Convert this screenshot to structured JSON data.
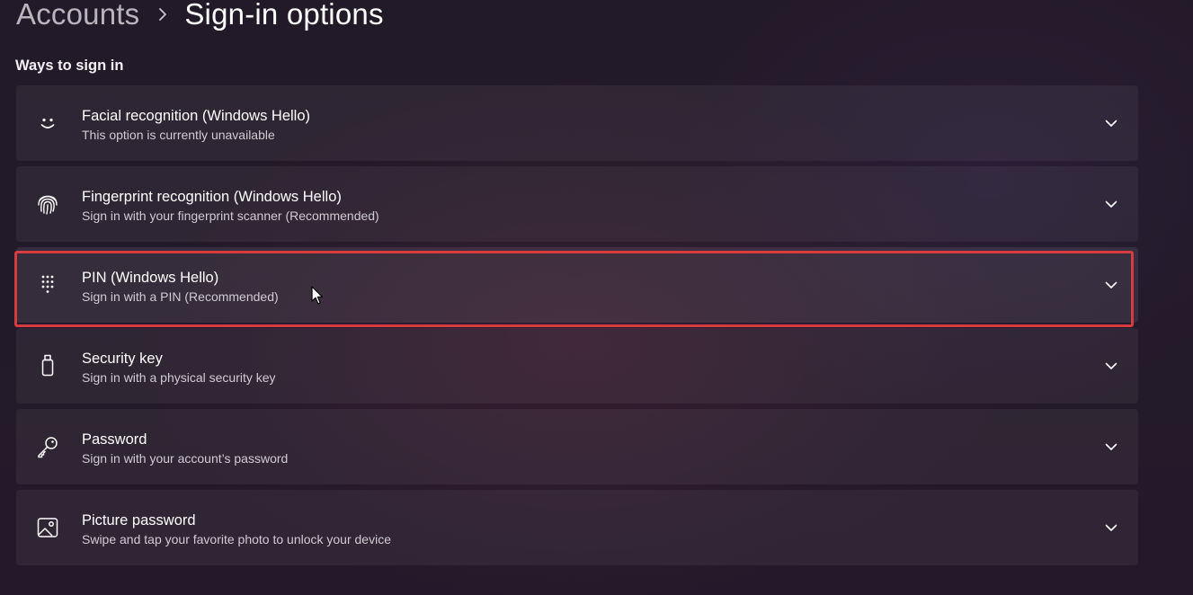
{
  "breadcrumb": {
    "parent": "Accounts",
    "separator_icon": "chevron-right-icon",
    "current": "Sign-in options"
  },
  "section": {
    "title": "Ways to sign in"
  },
  "options": [
    {
      "icon": "face-icon",
      "title": "Facial recognition (Windows Hello)",
      "description": "This option is currently unavailable"
    },
    {
      "icon": "fingerprint-icon",
      "title": "Fingerprint recognition (Windows Hello)",
      "description": "Sign in with your fingerprint scanner (Recommended)"
    },
    {
      "icon": "pin-keypad-icon",
      "title": "PIN (Windows Hello)",
      "description": "Sign in with a PIN (Recommended)"
    },
    {
      "icon": "usb-key-icon",
      "title": "Security key",
      "description": "Sign in with a physical security key"
    },
    {
      "icon": "key-icon",
      "title": "Password",
      "description": "Sign in with your account’s password"
    },
    {
      "icon": "picture-icon",
      "title": "Picture password",
      "description": "Swipe and tap your favorite photo to unlock your device"
    }
  ],
  "colors": {
    "highlight_border": "#d63b3f",
    "row_background": "#2e2636",
    "page_background": "#231a29"
  }
}
